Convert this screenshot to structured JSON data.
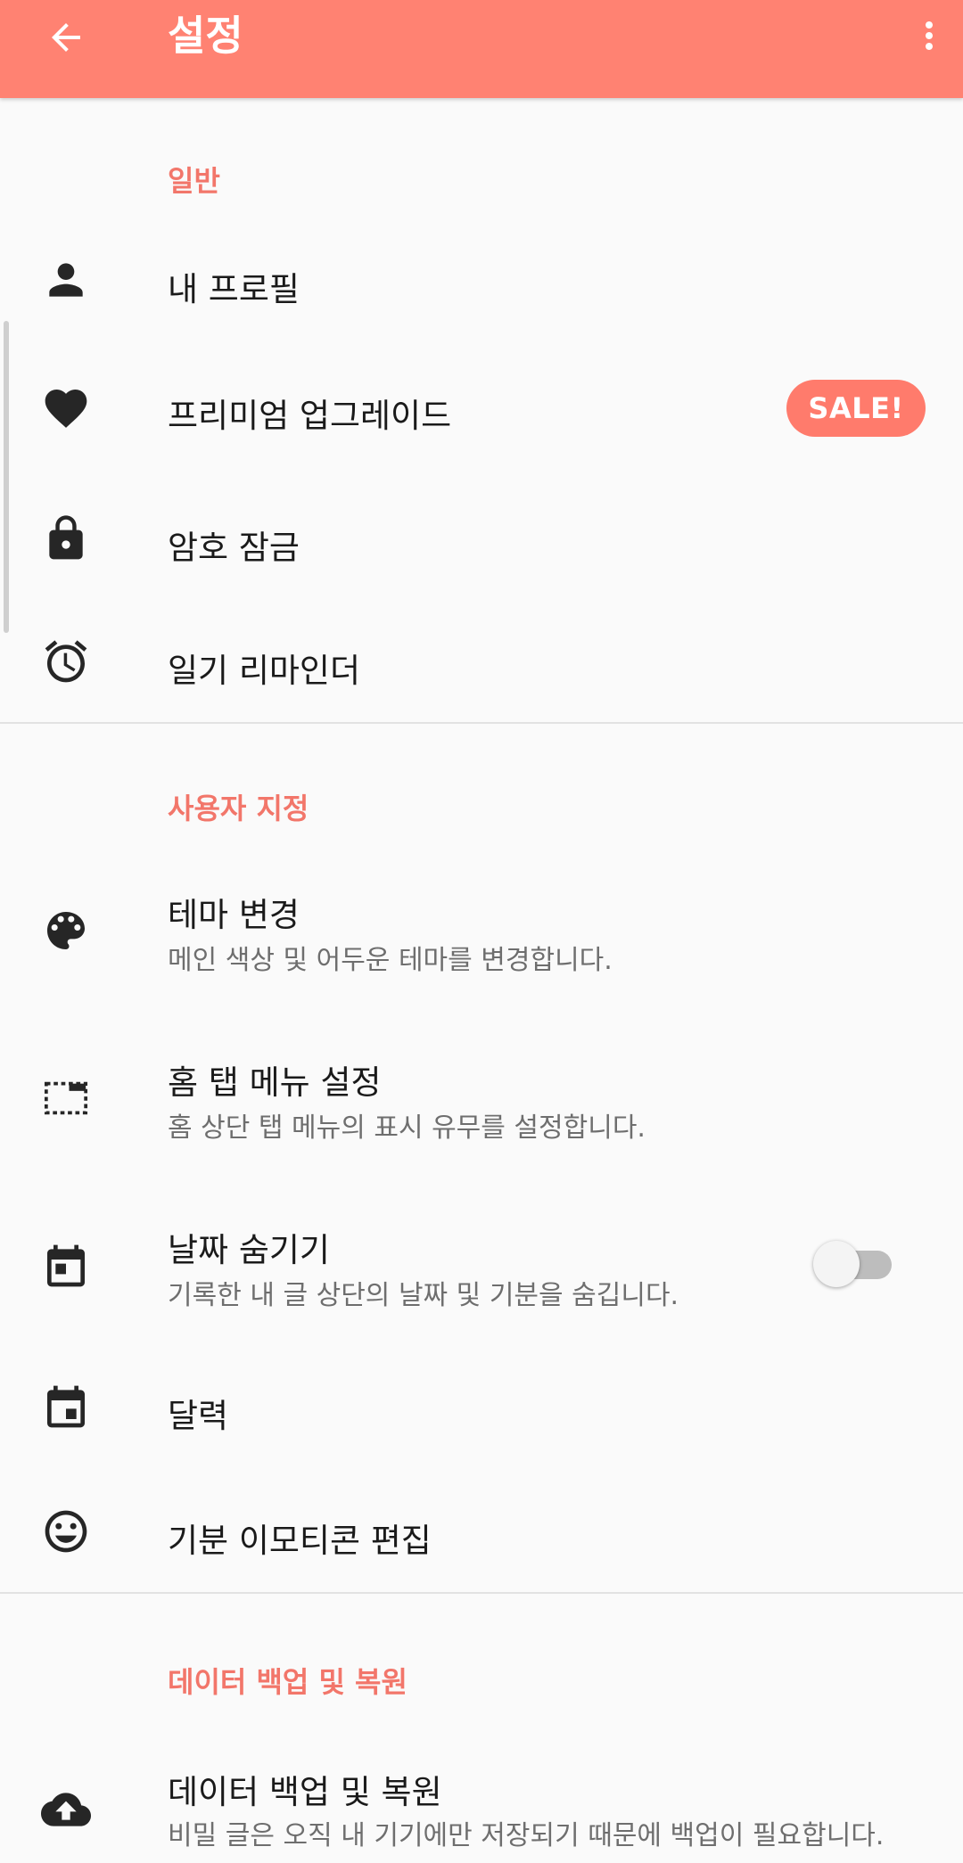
{
  "appbar": {
    "title": "설정",
    "background": "#ff8272"
  },
  "sections": {
    "general": {
      "header": "일반",
      "items": {
        "profile": {
          "label": "내 프로필",
          "icon": "person-icon"
        },
        "premium": {
          "label": "프리미엄 업그레이드",
          "badge": "SALE!",
          "icon": "heart-icon"
        },
        "lock": {
          "label": "암호 잠금",
          "icon": "lock-icon"
        },
        "reminder": {
          "label": "일기 리마인더",
          "icon": "alarm-icon"
        }
      }
    },
    "custom": {
      "header": "사용자 지정",
      "items": {
        "theme": {
          "label": "테마 변경",
          "sub": "메인 색상 및 어두운 테마를 변경합니다.",
          "icon": "palette-icon"
        },
        "home_tab": {
          "label": "홈 탭 메뉴 설정",
          "sub": "홈 상단 탭 메뉴의 표시 유무를 설정합니다.",
          "icon": "tab-layout-icon"
        },
        "hide_date": {
          "label": "날짜 숨기기",
          "sub": "기록한 내 글 상단의 날짜 및 기분을 숨깁니다.",
          "icon": "calendar-icon",
          "toggle_on": false
        },
        "calendar": {
          "label": "달력",
          "icon": "calendar-today-icon"
        },
        "mood": {
          "label": "기분 이모티콘 편집",
          "icon": "smiley-icon"
        }
      }
    },
    "backup": {
      "header": "데이터 백업 및 복원",
      "items": {
        "backup": {
          "label": "데이터 백업 및 복원",
          "sub": "비밀 글은 오직 내 기기에만 저장되기 때문에 백업이 필요합니다.",
          "icon": "cloud-upload-icon"
        }
      }
    }
  },
  "colors": {
    "accent": "#f2766a",
    "badge": "#ff7b6c",
    "icon": "#262626"
  }
}
